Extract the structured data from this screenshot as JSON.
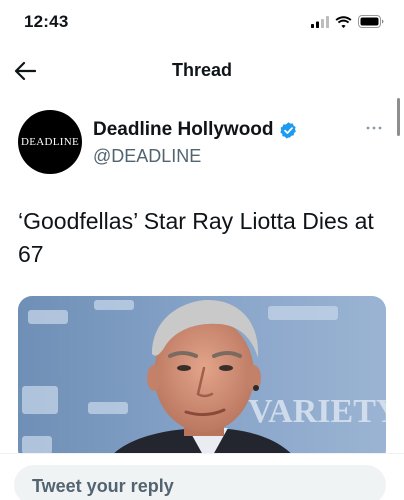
{
  "status_bar": {
    "time": "12:43",
    "icons": [
      "signal-icon",
      "wifi-icon",
      "battery-icon"
    ]
  },
  "header": {
    "title": "Thread",
    "back_icon": "arrow-left-icon"
  },
  "tweet": {
    "author": {
      "name": "Deadline Hollywood",
      "handle": "@DEADLINE",
      "verified": true,
      "avatar_text": "DEADLINE"
    },
    "text": "‘Goodfellas’ Star Ray Liotta Dies at 67",
    "media": {
      "type": "photo",
      "backdrop_logo": "VARIETY"
    }
  },
  "reply": {
    "placeholder": "Tweet your reply"
  },
  "colors": {
    "accent": "#1d9bf0",
    "text": "#0f1419",
    "secondary": "#536471",
    "input_bg": "#eff3f4"
  }
}
